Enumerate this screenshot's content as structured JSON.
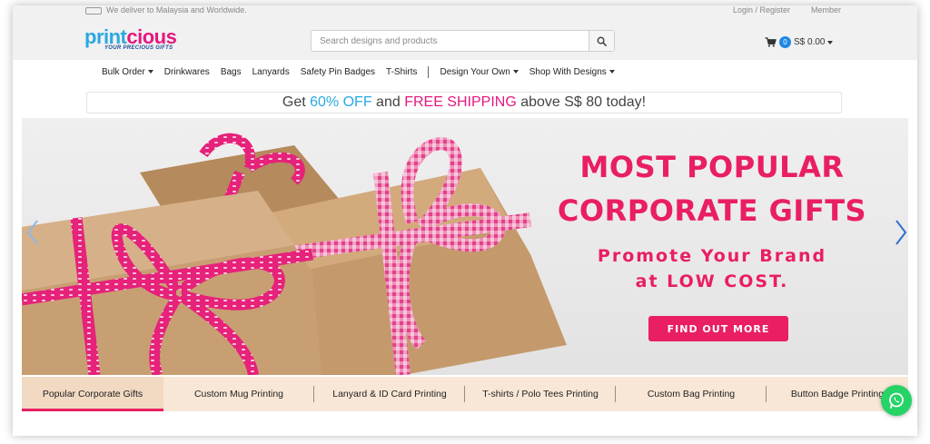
{
  "topbar": {
    "delivery_text": "We deliver to Malaysia and Worldwide.",
    "account_text": "Login / Register",
    "member_text": "Member"
  },
  "logo": {
    "text_part1": "print",
    "text_part2": "cious",
    "tagline": "YOUR PRECIOUS GIFTS"
  },
  "search": {
    "placeholder": "Search designs and products",
    "icon": "search-icon"
  },
  "cart": {
    "icon": "cart-icon",
    "count": "0",
    "total": "S$ 0.00"
  },
  "nav": {
    "items": [
      {
        "label": "Bulk Order",
        "dropdown": true
      },
      {
        "label": "Drinkwares"
      },
      {
        "label": "Bags"
      },
      {
        "label": "Lanyards"
      },
      {
        "label": "Safety Pin Badges"
      },
      {
        "label": "T-Shirts"
      },
      {
        "label": "Design Your Own",
        "dropdown": true
      },
      {
        "label": "Shop With Designs",
        "dropdown": true
      }
    ]
  },
  "promo": {
    "part1": "Get ",
    "highlight1": "60% OFF",
    "part2": " and ",
    "highlight2": "FREE SHIPPING",
    "part3": " above S$ 80 today!"
  },
  "hero": {
    "title_line1": "MOST POPULAR",
    "title_line2": "CORPORATE GIFTS",
    "subtitle_line1": "Promote Your Brand",
    "subtitle_line2": "at LOW COST.",
    "cta_label": "FIND OUT MORE"
  },
  "tabs": [
    {
      "label": "Popular Corporate Gifts",
      "active": true
    },
    {
      "label": "Custom Mug Printing",
      "active": false
    },
    {
      "label": "Lanyard & ID Card Printing",
      "active": false
    },
    {
      "label": "T-shirts / Polo Tees Printing",
      "active": false
    },
    {
      "label": "Custom Bag Printing",
      "active": false
    },
    {
      "label": "Button Badge Printing",
      "active": false
    }
  ],
  "colors": {
    "brand_blue": "#29a9e0",
    "brand_pink": "#e5187f",
    "hero_pink": "#e91e63",
    "tab_bar_bg": "#f8e7d6",
    "whatsapp_green": "#25d366"
  }
}
